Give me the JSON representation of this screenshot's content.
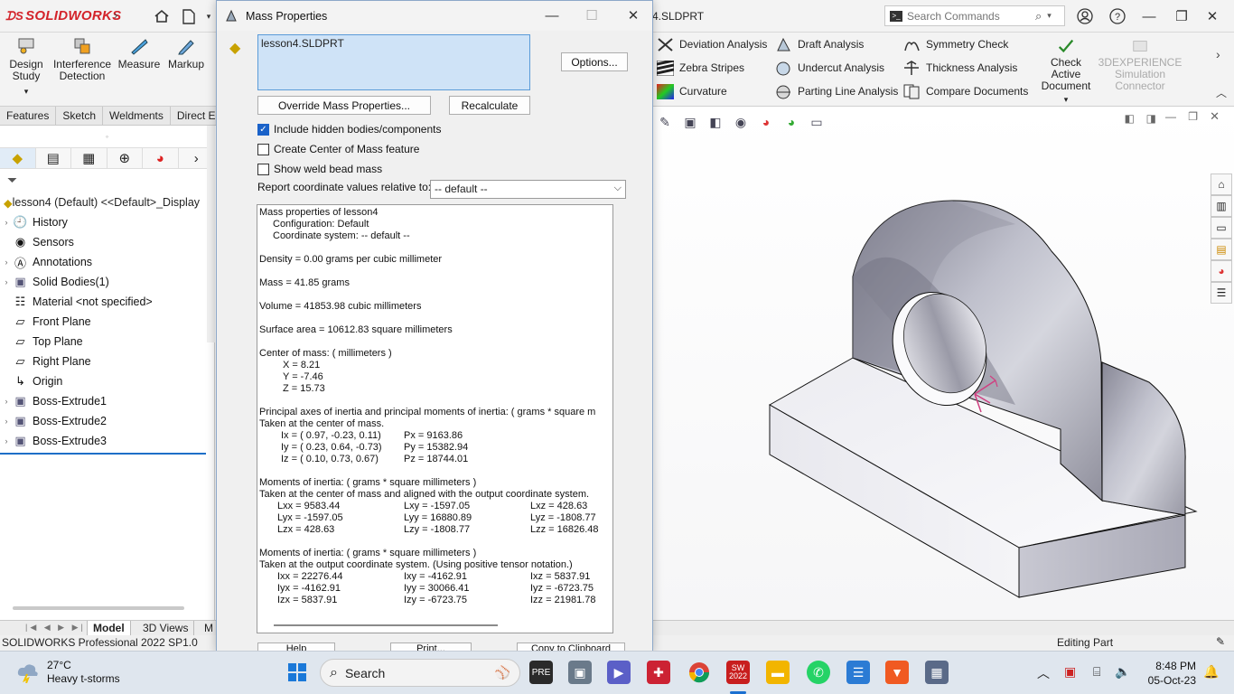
{
  "app": {
    "logo": "SOLIDWORKS",
    "doc_title": "4.SLDPRT",
    "search_placeholder": "Search Commands"
  },
  "command_manager": {
    "big_buttons": [
      "Design Study",
      "Interference Detection",
      "Measure",
      "Markup"
    ],
    "col1": [
      "Deviation Analysis",
      "Zebra Stripes",
      "Curvature"
    ],
    "col2": [
      "Draft Analysis",
      "Undercut Analysis",
      "Parting Line Analysis"
    ],
    "col3": [
      "Symmetry Check",
      "Thickness Analysis",
      "Compare Documents"
    ],
    "check_active": "Check Active Document",
    "experience": "3DEXPERIENCE Simulation Connector"
  },
  "tabs": [
    "Features",
    "Sketch",
    "Weldments",
    "Direct E"
  ],
  "tree": {
    "root": "lesson4 (Default) <<Default>_Display",
    "items": [
      {
        "label": "History",
        "exp": true
      },
      {
        "label": "Sensors",
        "exp": false
      },
      {
        "label": "Annotations",
        "exp": true
      },
      {
        "label": "Solid Bodies(1)",
        "exp": true
      },
      {
        "label": "Material <not specified>",
        "exp": false
      },
      {
        "label": "Front Plane",
        "exp": false
      },
      {
        "label": "Top Plane",
        "exp": false
      },
      {
        "label": "Right Plane",
        "exp": false
      },
      {
        "label": "Origin",
        "exp": false
      },
      {
        "label": "Boss-Extrude1",
        "exp": true
      },
      {
        "label": "Boss-Extrude2",
        "exp": true
      },
      {
        "label": "Boss-Extrude3",
        "exp": true
      }
    ]
  },
  "model_tabs": [
    "Model",
    "3D Views",
    "M"
  ],
  "status": {
    "left": "SOLIDWORKS Professional 2022 SP1.0",
    "right": "Editing Part"
  },
  "dialog": {
    "title": "Mass Properties",
    "selection": "lesson4.SLDPRT",
    "options_btn": "Options...",
    "override_btn": "Override Mass Properties...",
    "recalc_btn": "Recalculate",
    "chk_hidden": "Include hidden bodies/components",
    "chk_com": "Create Center of Mass feature",
    "chk_weld": "Show weld bead mass",
    "report_label": "Report coordinate values relative to:",
    "report_value": "-- default --",
    "bottom_btns": [
      "Help",
      "Print...",
      "Copy to Clipboard"
    ],
    "results": {
      "l1": "Mass properties of lesson4",
      "l2": "Configuration: Default",
      "l3": "Coordinate system: -- default --",
      "density": "Density = 0.00 grams per cubic millimeter",
      "mass": "Mass = 41.85 grams",
      "volume": "Volume = 41853.98 cubic millimeters",
      "surface": "Surface area = 10612.83  square millimeters",
      "com_h": "Center of mass: ( millimeters )",
      "com_x": "X = 8.21",
      "com_y": "Y = -7.46",
      "com_z": "Z = 15.73",
      "pa_h1": "Principal axes of inertia and principal moments of inertia: ( grams *  square m",
      "pa_h2": "Taken at the center of mass.",
      "ix": "Ix = ( 0.97, -0.23,  0.11)",
      "px": "Px = 9163.86",
      "iy": "Iy = ( 0.23,  0.64, -0.73)",
      "py": "Py = 15382.94",
      "iz": "Iz = ( 0.10,  0.73,  0.67)",
      "pz": "Pz = 18744.01",
      "m1_h1": "Moments of inertia: ( grams *  square millimeters )",
      "m1_h2": "Taken at the center of mass and aligned with the output coordinate system.",
      "lxx": "Lxx = 9583.44",
      "lxy": "Lxy = -1597.05",
      "lxz": "Lxz = 428.63",
      "lyx": "Lyx = -1597.05",
      "lyy": "Lyy = 16880.89",
      "lyz": "Lyz = -1808.77",
      "lzx": "Lzx = 428.63",
      "lzy": "Lzy = -1808.77",
      "lzz": "Lzz = 16826.48",
      "m2_h1": "Moments of inertia: ( grams *  square millimeters )",
      "m2_h2": "Taken at the output coordinate system. (Using positive tensor notation.)",
      "ixx": "Ixx = 22276.44",
      "ixy": "Ixy = -4162.91",
      "ixz": "Ixz = 5837.91",
      "iyx": "Iyx = -4162.91",
      "iyy": "Iyy = 30066.41",
      "iyz": "Iyz = -6723.75",
      "izx": "Izx = 5837.91",
      "izy": "Izy = -6723.75",
      "izz": "Izz = 21981.78"
    }
  },
  "taskbar": {
    "temp": "27°C",
    "weather": "Heavy t-storms",
    "search": "Search",
    "time": "8:48 PM",
    "date": "05-Oct-23",
    "sw_badge": "2022"
  },
  "colors": {
    "accent": "#1a62c9",
    "sw_red": "#d3232a",
    "selection_bg": "#cfe3f7"
  }
}
